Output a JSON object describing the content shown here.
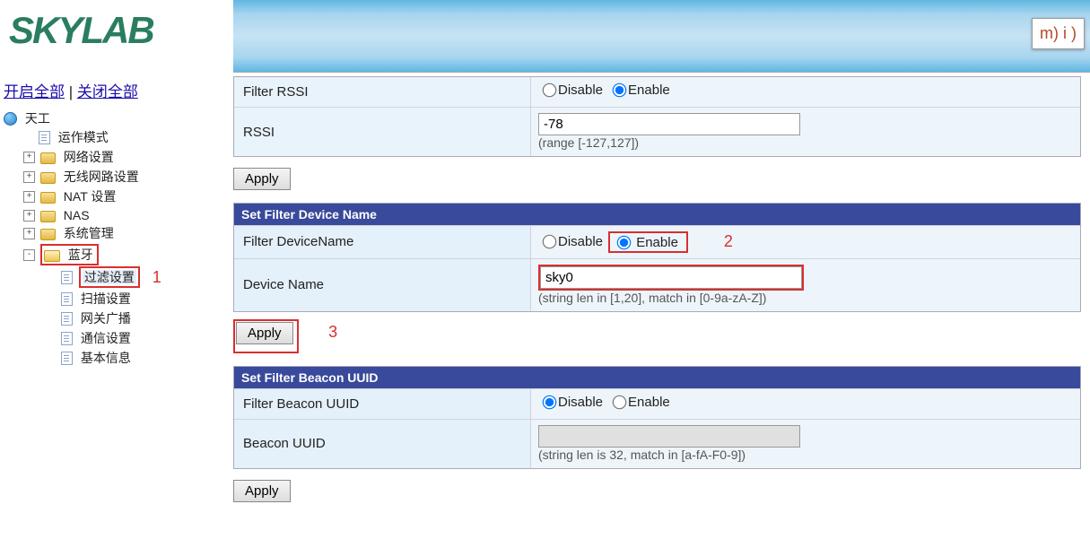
{
  "brand": "SKYLAB",
  "mi_badge": "m) i )",
  "toggle": {
    "open_all": "开启全部",
    "close_all": "关闭全部",
    "separator": " | "
  },
  "tree": {
    "root": "天工",
    "items": [
      {
        "label": "运作模式"
      },
      {
        "label": "网络设置"
      },
      {
        "label": "无线网路设置"
      },
      {
        "label": "NAT 设置"
      },
      {
        "label": "NAS"
      },
      {
        "label": "系统管理"
      },
      {
        "label": "蓝牙",
        "children": [
          {
            "label": "过滤设置"
          },
          {
            "label": "扫描设置"
          },
          {
            "label": "网关广播"
          },
          {
            "label": "通信设置"
          },
          {
            "label": "基本信息"
          }
        ]
      }
    ]
  },
  "annot": {
    "n1": "1",
    "n2": "2",
    "n3": "3"
  },
  "radio": {
    "disable": "Disable",
    "enable": "Enable"
  },
  "rssi": {
    "filter_label": "Filter RSSI",
    "filter_value": "enable",
    "value_label": "RSSI",
    "value": "-78",
    "hint": "(range [-127,127])",
    "apply": "Apply"
  },
  "devname": {
    "title": "Set Filter Device Name",
    "filter_label": "Filter DeviceName",
    "filter_value": "enable",
    "name_label": "Device Name",
    "name_value": "sky0",
    "hint": "(string len in [1,20], match in [0-9a-zA-Z])",
    "apply": "Apply"
  },
  "uuid": {
    "title": "Set Filter Beacon UUID",
    "filter_label": "Filter Beacon UUID",
    "filter_value": "disable",
    "value_label": "Beacon UUID",
    "value": "",
    "hint": "(string len is 32, match in [a-fA-F0-9])",
    "apply": "Apply"
  }
}
